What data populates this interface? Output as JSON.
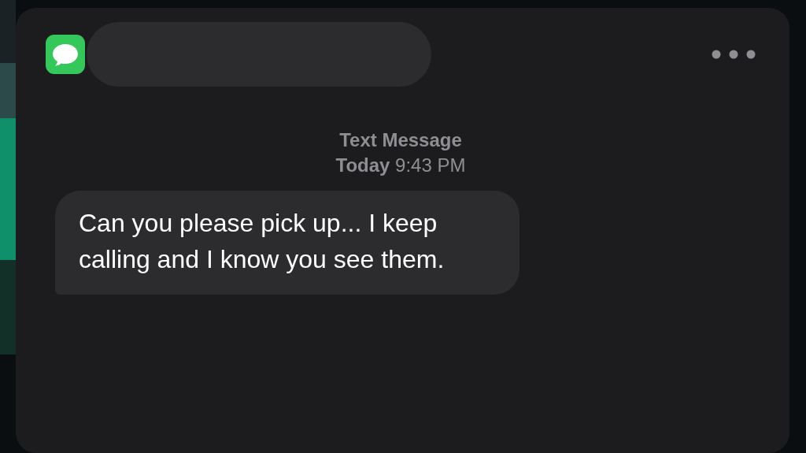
{
  "header_label": "Text Message",
  "timestamp": "**Today** 9:43 PM",
  "messages": [
    {
      "kind": "incoming",
      "text": "Can you please pick up... I keep calling and I know you see them."
    }
  ]
}
